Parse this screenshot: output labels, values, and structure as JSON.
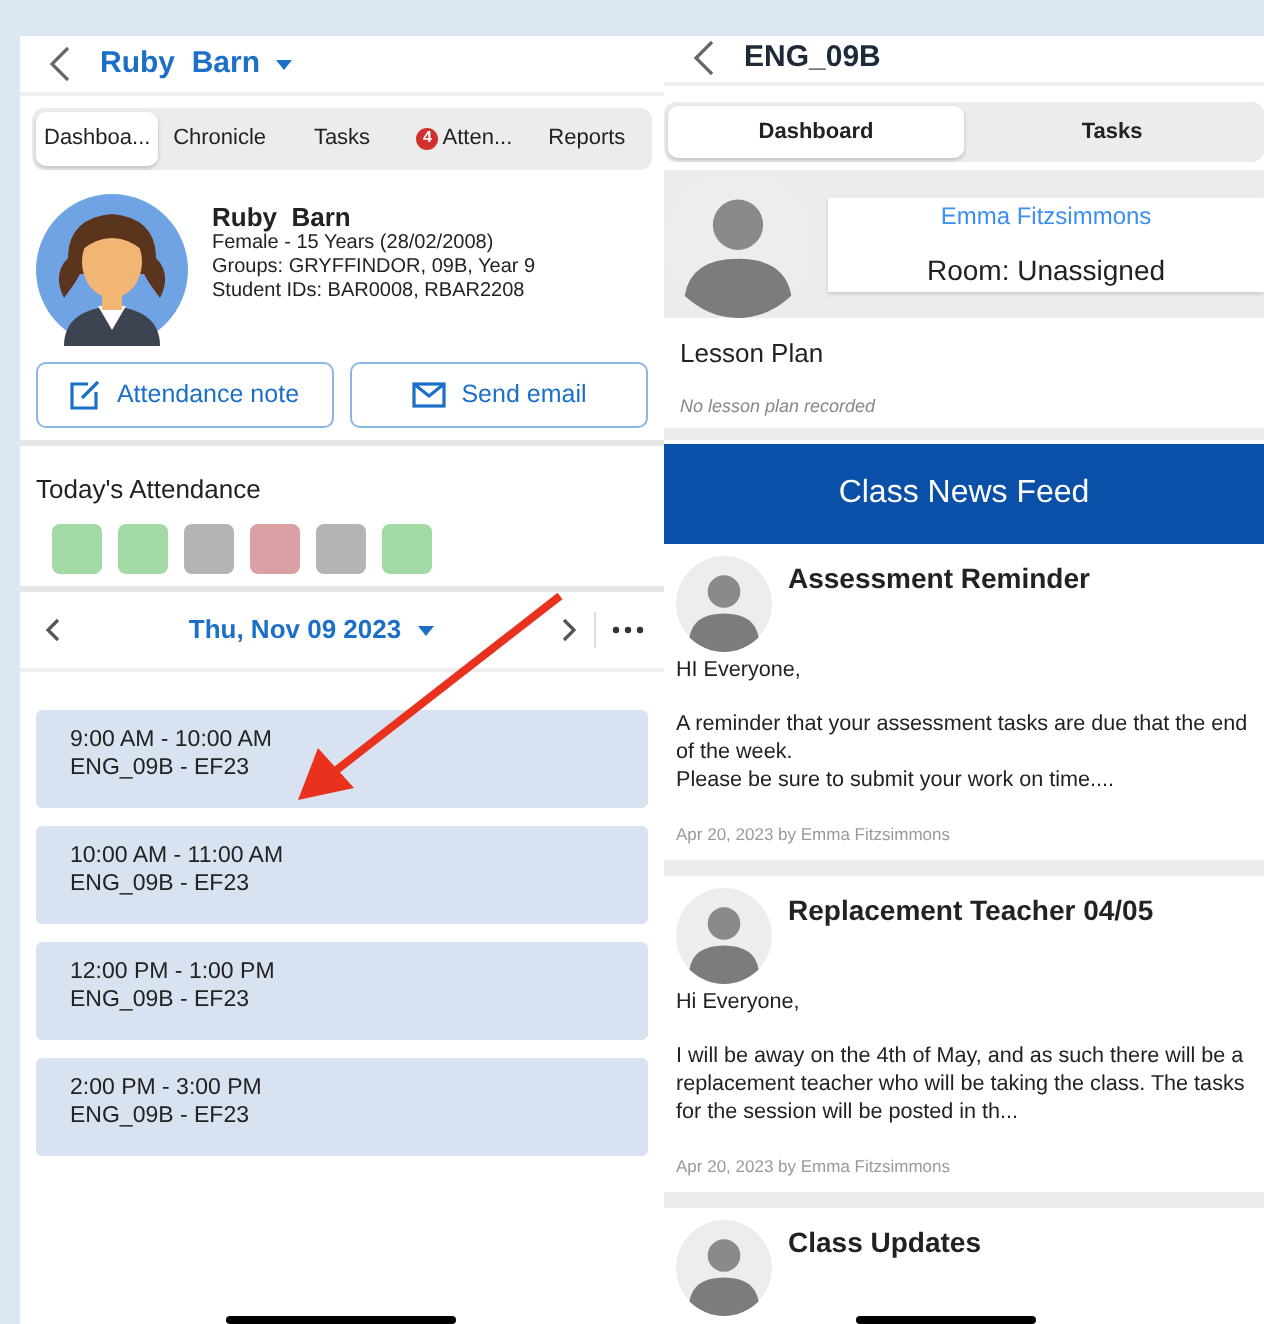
{
  "student_screen": {
    "title": "Ruby  Barn",
    "tabs": [
      {
        "label": "Dashboa...",
        "selected": true
      },
      {
        "label": "Chronicle",
        "selected": false
      },
      {
        "label": "Tasks",
        "selected": false
      },
      {
        "label": "Atten...",
        "selected": false,
        "badge": "4"
      },
      {
        "label": "Reports",
        "selected": false
      }
    ],
    "profile": {
      "name": "Ruby  Barn",
      "lines": [
        "Female - 15 Years (28/02/2008)",
        "Groups: GRYFFINDOR, 09B, Year 9",
        "Student IDs: BAR0008, RBAR2208"
      ]
    },
    "buttons": [
      {
        "label": "Attendance note",
        "kind": "note"
      },
      {
        "label": "Send email",
        "kind": "email"
      }
    ],
    "attendance": {
      "title": "Today's Attendance",
      "marks": [
        {
          "color": "#a3d9a5"
        },
        {
          "color": "#a3d9a5"
        },
        {
          "color": "#b4b4b4"
        },
        {
          "color": "#dba0a3"
        },
        {
          "color": "#b4b4b4"
        },
        {
          "color": "#a3d9a5"
        }
      ]
    },
    "date": "Thu, Nov 09 2023",
    "periods": [
      {
        "time": "9:00 AM - 10:00 AM",
        "class": "ENG_09B - EF23"
      },
      {
        "time": "10:00 AM - 11:00 AM",
        "class": "ENG_09B - EF23"
      },
      {
        "time": "12:00 PM - 1:00 PM",
        "class": "ENG_09B - EF23"
      },
      {
        "time": "2:00 PM - 3:00 PM",
        "class": "ENG_09B - EF23"
      }
    ]
  },
  "class_screen": {
    "title": "ENG_09B",
    "tabs": [
      {
        "label": "Dashboard",
        "selected": true
      },
      {
        "label": "Tasks",
        "selected": false
      }
    ],
    "teacher": "Emma Fitzsimmons",
    "room": "Room: Unassigned",
    "lesson_plan": {
      "title": "Lesson Plan",
      "note": "No lesson plan recorded"
    },
    "feed_title": "Class News Feed",
    "posts": [
      {
        "title": "Assessment Reminder",
        "body": [
          [
            "HI Everyone,"
          ],
          [
            "A reminder that your assessment tasks are due that the end of the week.",
            "Please be sure to submit your work on time...."
          ]
        ],
        "meta": "Apr 20, 2023 by Emma Fitzsimmons"
      },
      {
        "title": "Replacement Teacher 04/05",
        "body": [
          [
            "Hi Everyone,"
          ],
          [
            "I will be away on the 4th of May, and as such there will be a replacement teacher who will be taking the class. The tasks for the session will be posted in th..."
          ]
        ],
        "meta": "Apr 20, 2023 by Emma Fitzsimmons"
      },
      {
        "title": "Class Updates"
      }
    ]
  }
}
